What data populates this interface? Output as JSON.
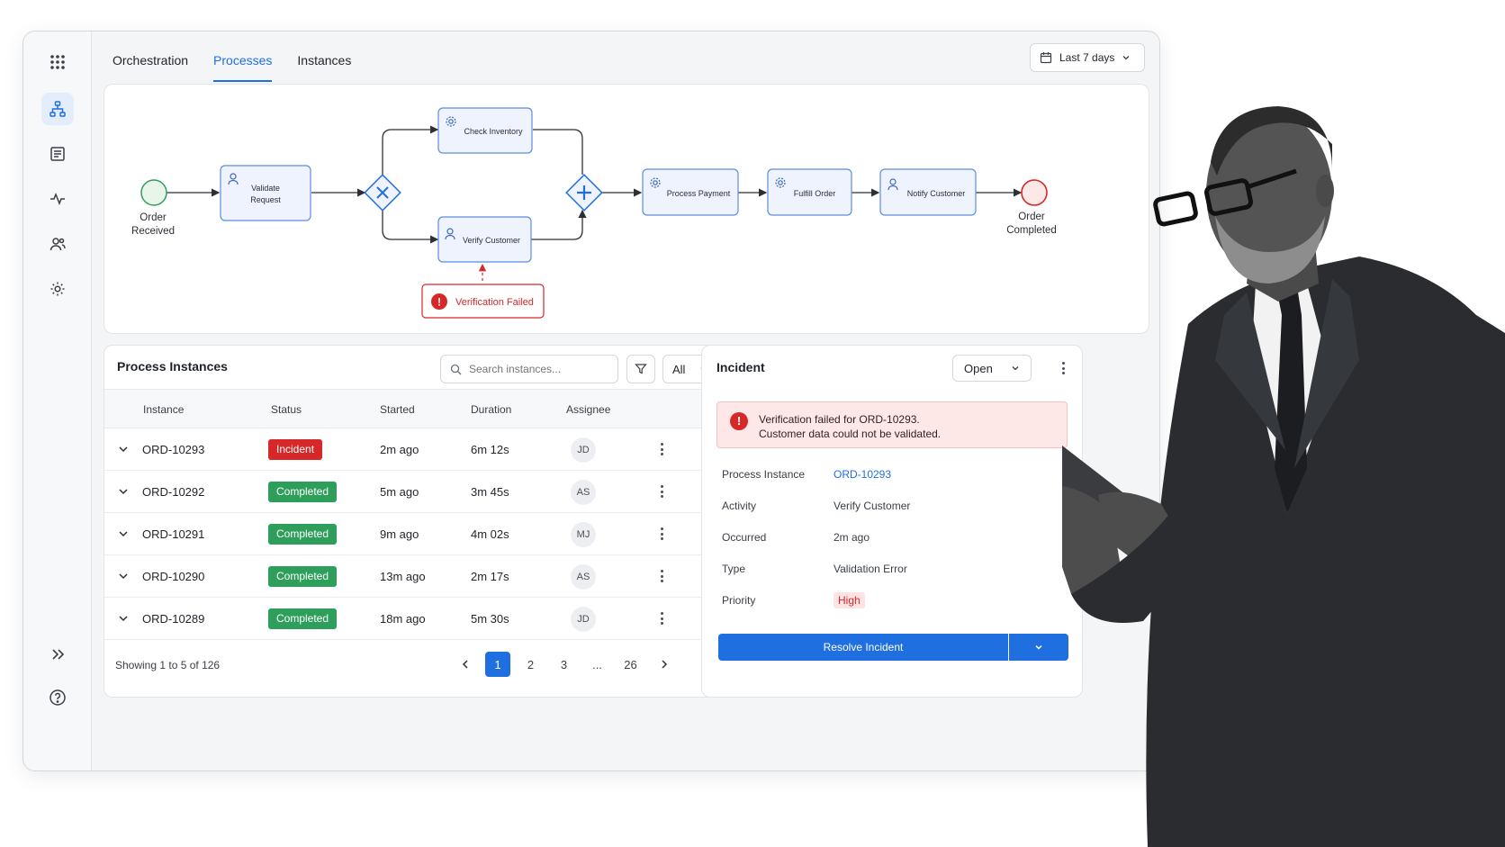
{
  "app": {
    "tabs": [
      {
        "label": "Orchestration",
        "active": false
      },
      {
        "label": "Processes",
        "active": true
      },
      {
        "label": "Instances",
        "active": false
      }
    ],
    "date_range": "Last 7 days"
  },
  "sidebar": {
    "items": [
      {
        "icon": "grid-icon"
      },
      {
        "icon": "process-tree-icon",
        "active": true
      },
      {
        "icon": "document-list-icon"
      },
      {
        "icon": "activity-pulse-icon"
      },
      {
        "icon": "users-icon"
      },
      {
        "icon": "settings-gear-icon"
      }
    ],
    "bottom": [
      {
        "icon": "expand-chevrons-icon"
      },
      {
        "icon": "help-icon"
      }
    ]
  },
  "diagram": {
    "start": "Order\nReceived",
    "start_l1": "Order",
    "start_l2": "Received",
    "validate_l1": "Validate",
    "validate_l2": "Request",
    "check_inventory": "Check Inventory",
    "verify_customer": "Verify Customer",
    "process_payment": "Process Payment",
    "fulfill_order": "Fulfill Order",
    "notify_customer": "Notify Customer",
    "end_l1": "Order",
    "end_l2": "Completed",
    "error": "Verification Failed"
  },
  "instances": {
    "title": "Process Instances",
    "search_placeholder": "Search instances...",
    "filter_value": "All",
    "columns": {
      "instance": "Instance",
      "status": "Status",
      "started": "Started",
      "duration": "Duration",
      "assignee": "Assignee"
    },
    "rows": [
      {
        "id": "ORD-10293",
        "status": "Incident",
        "started": "2m ago",
        "duration": "6m 12s",
        "assignee": "JD"
      },
      {
        "id": "ORD-10292",
        "status": "Completed",
        "started": "5m ago",
        "duration": "3m 45s",
        "assignee": "AS"
      },
      {
        "id": "ORD-10291",
        "status": "Completed",
        "started": "9m ago",
        "duration": "4m 02s",
        "assignee": "MJ"
      },
      {
        "id": "ORD-10290",
        "status": "Completed",
        "started": "13m ago",
        "duration": "2m 17s",
        "assignee": "AS"
      },
      {
        "id": "ORD-10289",
        "status": "Completed",
        "started": "18m ago",
        "duration": "5m 30s",
        "assignee": "JD"
      }
    ],
    "footer": "Showing 1 to 5 of 126",
    "pages": [
      "1",
      "2",
      "3",
      "...",
      "26"
    ]
  },
  "incident": {
    "title": "Incident",
    "state": "Open",
    "alert_l1": "Verification failed for ORD-10293.",
    "alert_l2": "Customer data could not be validated.",
    "fields": {
      "process_instance_label": "Process Instance",
      "process_instance": "ORD-10293",
      "activity_label": "Activity",
      "activity": "Verify Customer",
      "occurred_label": "Occurred",
      "occurred": "2m ago",
      "type_label": "Type",
      "type": "Validation Error",
      "priority_label": "Priority",
      "priority": "High"
    },
    "resolve_label": "Resolve Incident"
  },
  "colors": {
    "accent": "#1f6fe0",
    "incident": "#d62828",
    "completed": "#2e9e5b"
  }
}
